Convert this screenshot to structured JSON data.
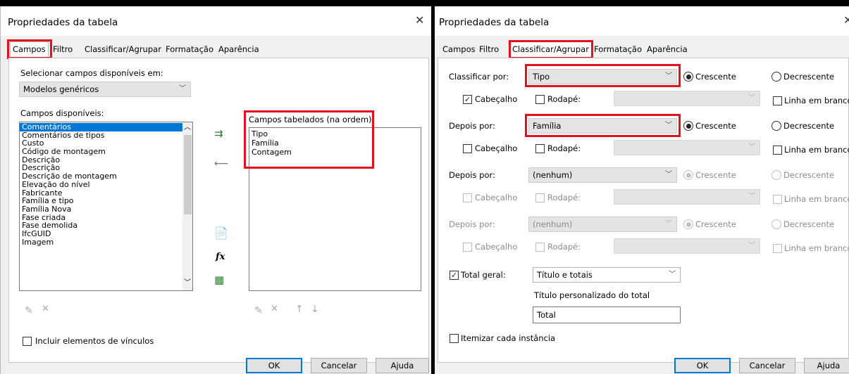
{
  "dialog1": {
    "title": "Propriedades da tabela",
    "tabs": [
      "Campos",
      "Filtro",
      "Classificar/Agrupar",
      "Formatação",
      "Aparência"
    ],
    "select_label": "Selecionar campos disponíveis em:",
    "select_value": "Modelos genéricos",
    "available_label": "Campos disponíveis:",
    "available_fields": [
      "Comentários",
      "Comentários de tipos",
      "Custo",
      "Código de montagem",
      "Descrição",
      "Descrição",
      "Descrição de montagem",
      "Elevação do nível",
      "Fabricante",
      "Família e tipo",
      "Família Nova",
      "Fase criada",
      "Fase demolida",
      "IfcGUID",
      "Imagem"
    ],
    "scheduled_label": "Campos tabelados (na ordem):",
    "scheduled_fields": [
      "Tipo",
      "Família",
      "Contagem"
    ],
    "include_links_label": "Incluir elementos de vínculos",
    "buttons": {
      "ok": "OK",
      "cancel": "Cancelar",
      "help": "Ajuda"
    }
  },
  "dialog2": {
    "title": "Propriedades da tabela",
    "tabs": [
      "Campos",
      "Filtro",
      "Classificar/Agrupar",
      "Formatação",
      "Aparência"
    ],
    "sort_rows": [
      {
        "label": "Classificar por:",
        "value": "Tipo",
        "ascending": "Crescente",
        "descending": "Decrescente",
        "header": "Cabeçalho",
        "footer": "Rodapé:",
        "blank_line": "Linha em branco"
      },
      {
        "label": "Depois por:",
        "value": "Família",
        "ascending": "Crescente",
        "descending": "Decrescente",
        "header": "Cabeçalho",
        "footer": "Rodapé:",
        "blank_line": "Linha em branco"
      },
      {
        "label": "Depois por:",
        "value": "(nenhum)",
        "ascending": "Crescente",
        "descending": "Decrescente",
        "header": "Cabeçalho",
        "footer": "Rodapé:",
        "blank_line": "Linha em branco"
      },
      {
        "label": "Depois por:",
        "value": "(nenhum)",
        "ascending": "Crescente",
        "descending": "Decrescente",
        "header": "Cabeçalho",
        "footer": "Rodapé:",
        "blank_line": "Linha em branco"
      }
    ],
    "grand_total_label": "Total geral:",
    "grand_total_value": "Título e totais",
    "custom_total_label": "Título personalizado do total",
    "custom_total_value": "Total",
    "itemize_label": "Itemizar cada instância",
    "buttons": {
      "ok": "OK",
      "cancel": "Cancelar",
      "help": "Ajuda"
    }
  },
  "colors": {
    "highlight": "#e3101f",
    "selection": "#0078d7",
    "dialog_bg": "#f0f0f0"
  }
}
